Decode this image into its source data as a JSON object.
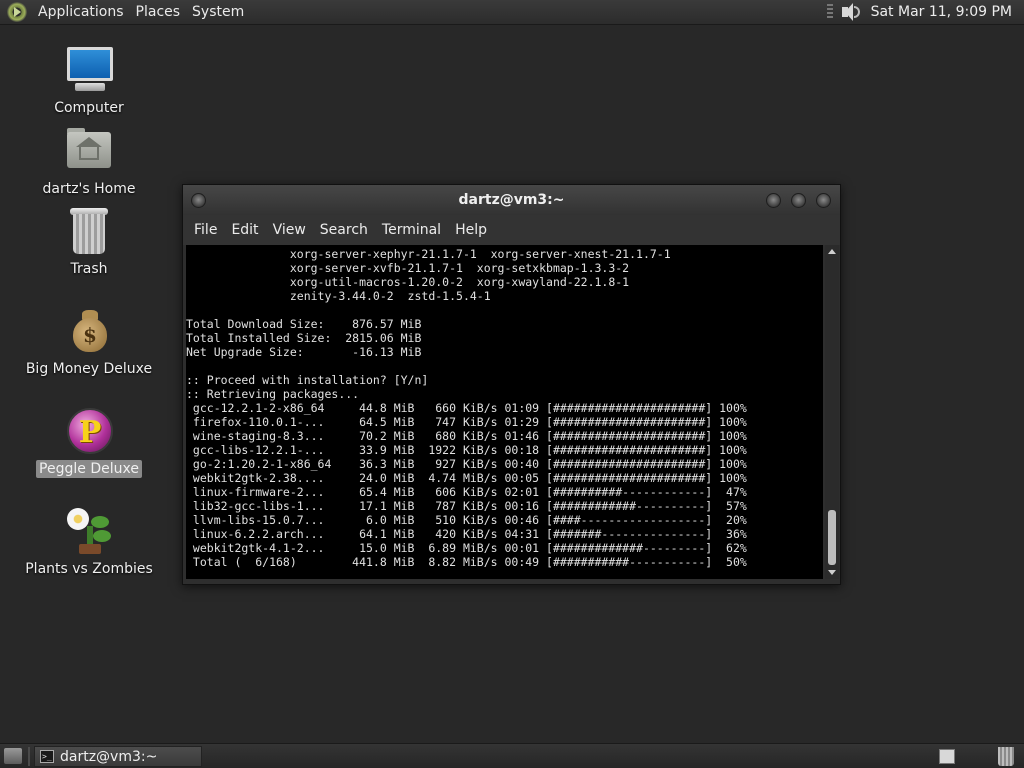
{
  "top_panel": {
    "menus": [
      "Applications",
      "Places",
      "System"
    ],
    "clock": "Sat Mar 11,  9:09 PM"
  },
  "desktop": {
    "icons": [
      {
        "label": "Computer",
        "icon": "computer-icon"
      },
      {
        "label": "dartz's Home",
        "icon": "home-folder-icon"
      },
      {
        "label": "Trash",
        "icon": "trash-icon"
      },
      {
        "label": "Big Money Deluxe",
        "icon": "money-bag-icon"
      },
      {
        "label": "Peggle Deluxe",
        "icon": "peggle-icon",
        "selected": true
      },
      {
        "label": "Plants vs Zombies",
        "icon": "plant-icon"
      }
    ]
  },
  "terminal": {
    "title": "dartz@vm3:~",
    "menu": [
      "File",
      "Edit",
      "View",
      "Search",
      "Terminal",
      "Help"
    ],
    "lines": [
      "               xorg-server-xephyr-21.1.7-1  xorg-server-xnest-21.1.7-1",
      "               xorg-server-xvfb-21.1.7-1  xorg-setxkbmap-1.3.3-2",
      "               xorg-util-macros-1.20.0-2  xorg-xwayland-22.1.8-1",
      "               zenity-3.44.0-2  zstd-1.5.4-1",
      "",
      "Total Download Size:    876.57 MiB",
      "Total Installed Size:  2815.06 MiB",
      "Net Upgrade Size:       -16.13 MiB",
      "",
      ":: Proceed with installation? [Y/n]",
      ":: Retrieving packages...",
      " gcc-12.2.1-2-x86_64     44.8 MiB   660 KiB/s 01:09 [######################] 100%",
      " firefox-110.0.1-...     64.5 MiB   747 KiB/s 01:29 [######################] 100%",
      " wine-staging-8.3...     70.2 MiB   680 KiB/s 01:46 [######################] 100%",
      " gcc-libs-12.2.1-...     33.9 MiB  1922 KiB/s 00:18 [######################] 100%",
      " go-2:1.20.2-1-x86_64    36.3 MiB   927 KiB/s 00:40 [######################] 100%",
      " webkit2gtk-2.38....     24.0 MiB  4.74 MiB/s 00:05 [######################] 100%",
      " linux-firmware-2...     65.4 MiB   606 KiB/s 02:01 [##########------------]  47%",
      " lib32-gcc-libs-1...     17.1 MiB   787 KiB/s 00:16 [############----------]  57%",
      " llvm-libs-15.0.7...      6.0 MiB   510 KiB/s 00:46 [####------------------]  20%",
      " linux-6.2.2.arch...     64.1 MiB   420 KiB/s 04:31 [#######---------------]  36%",
      " webkit2gtk-4.1-2...     15.0 MiB  6.89 MiB/s 00:01 [#############---------]  62%",
      " Total (  6/168)        441.8 MiB  8.82 MiB/s 00:49 [###########-----------]  50%"
    ]
  },
  "bottom_panel": {
    "task_label": "dartz@vm3:~"
  },
  "colors": {
    "desktop_bg": "#282828",
    "panel_bg": "#2c2c2c",
    "terminal_bg": "#000000",
    "terminal_fg": "#e0e0e0",
    "selection": "#8a8a8a"
  }
}
